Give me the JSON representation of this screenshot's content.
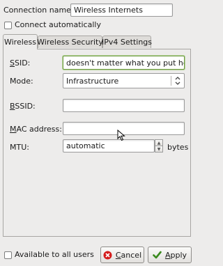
{
  "connection_name": {
    "label": "Connection name:",
    "value": "Wireless Internets"
  },
  "connect_automatically": {
    "label": "Connect automatically",
    "checked": false
  },
  "tabs": [
    {
      "label": "Wireless",
      "active": true
    },
    {
      "label": "Wireless Security",
      "active": false
    },
    {
      "label": "IPv4 Settings",
      "active": false
    }
  ],
  "wireless": {
    "ssid": {
      "label": "SSID:",
      "value": "doesn't matter what you put here"
    },
    "mode": {
      "label": "Mode:",
      "value": "Infrastructure"
    },
    "bssid": {
      "label": "BSSID:",
      "value": ""
    },
    "mac": {
      "label": "MAC address:",
      "value": ""
    },
    "mtu": {
      "label": "MTU:",
      "value": "automatic",
      "unit": "bytes"
    }
  },
  "available_all_users": {
    "label": "Available to all users",
    "checked": false
  },
  "buttons": {
    "cancel": "Cancel",
    "apply": "Apply"
  },
  "colors": {
    "cancel_icon": "#d41c1c",
    "apply_icon": "#3a8a1e",
    "focus_border": "#6e9a42"
  }
}
